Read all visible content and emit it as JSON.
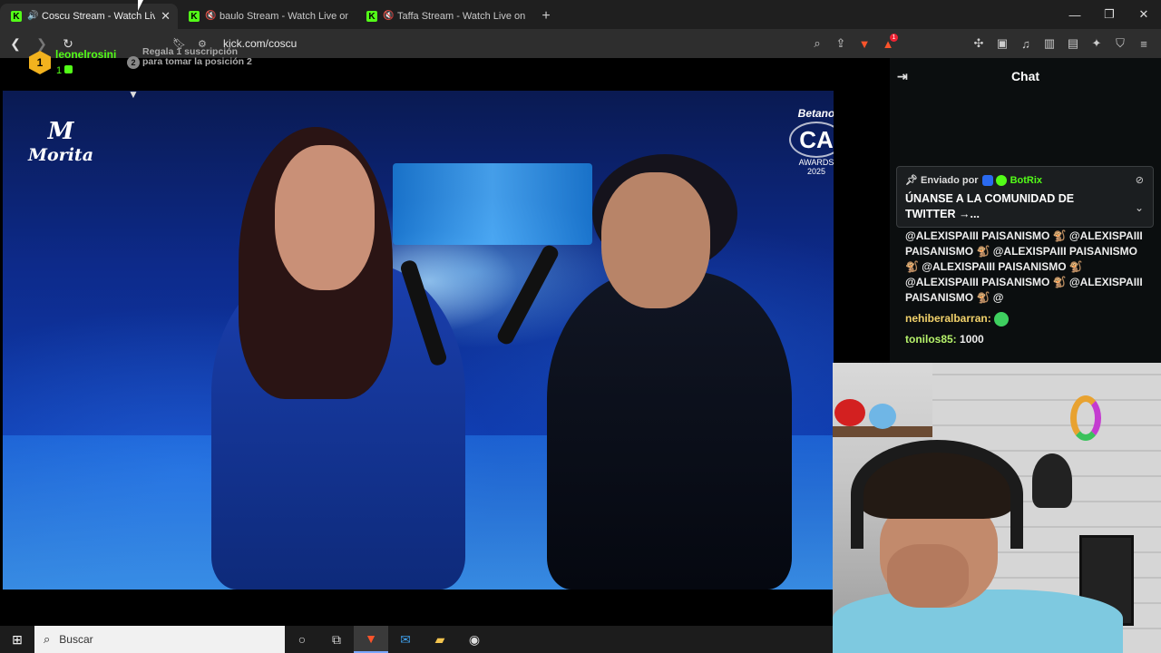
{
  "browser": {
    "tabs": [
      {
        "label": "Coscu Stream - Watch Live on Kick",
        "active": true,
        "sound": "🔊"
      },
      {
        "label": "baulo Stream - Watch Live on Kick",
        "active": false,
        "sound": "🔇"
      },
      {
        "label": "Taffa Stream - Watch Live on Kick",
        "active": false,
        "sound": "🔇"
      }
    ],
    "favicon_letter": "K",
    "tab_close": "✕",
    "new_tab": "+",
    "window_controls": {
      "minimize": "—",
      "maximize": "❐",
      "close": "✕"
    },
    "url": "kick.com/coscu",
    "notification_count": "1",
    "accent_color": "#53fc18"
  },
  "video": {
    "logo_left_mark": "M",
    "logo_left_text": "Morita",
    "logo_right_brand": "Betano",
    "logo_right_main": "CA",
    "logo_right_sub": "AWARDS",
    "logo_right_year": "2025"
  },
  "chat": {
    "title": "Chat",
    "leaderboard": {
      "rank1_number": "1",
      "rank1_name": "leonelrosini",
      "rank1_count": "1",
      "rank2_number": "2",
      "rank2_text": "Regala 1 suscripción para tomar la posición 2"
    },
    "pinned": {
      "sent_by_label": "Enviado por",
      "bot_name": "BotRix",
      "message": "ÚNANSE A LA COMUNIDAD DE TWITTER →..."
    },
    "messages": {
      "spam_text": "@ALEXISPAIII PAISANISMO 🐒 @ALEXISPAIII PAISANISMO 🐒 @ALEXISPAIII PAISANISMO 🐒 @ALEXISPAIII PAISANISMO 🐒 @ALEXISPAIII PAISANISMO 🐒 @ALEXISPAIII PAISANISMO 🐒 @",
      "msg2_user": "nehiberalbarran:",
      "msg3_user": "tonilos85:",
      "msg3_text": "1000"
    }
  },
  "taskbar": {
    "search_placeholder": "Buscar"
  }
}
